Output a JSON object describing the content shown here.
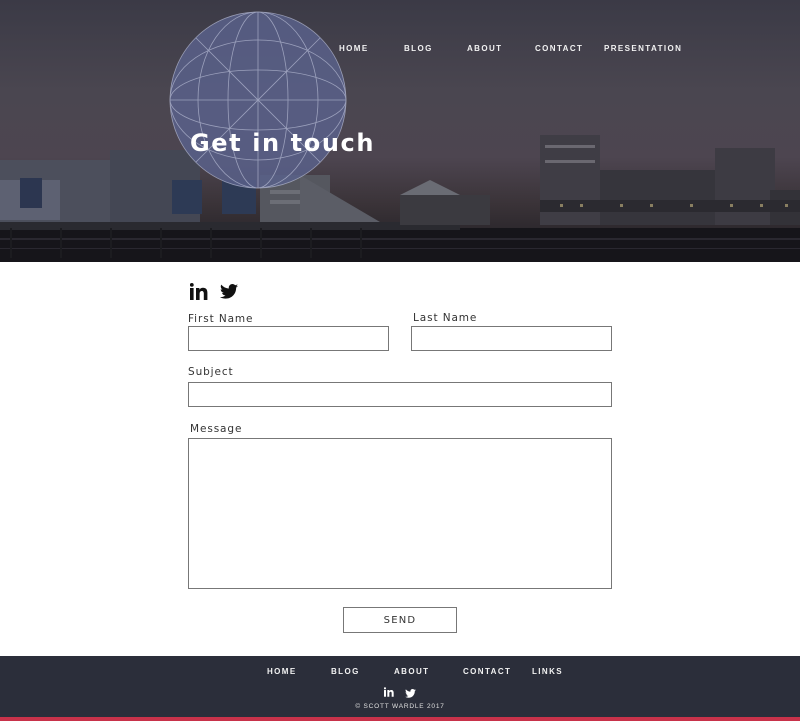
{
  "nav": {
    "items": [
      {
        "label": "HOME"
      },
      {
        "label": "BLOG"
      },
      {
        "label": "ABOUT"
      },
      {
        "label": "CONTACT"
      },
      {
        "label": "PRESENTATION"
      }
    ]
  },
  "hero": {
    "title": "Get in touch"
  },
  "social": {
    "icons": [
      "linkedin-icon",
      "twitter-icon"
    ]
  },
  "form": {
    "first_name_label": "First Name",
    "first_name_value": "",
    "last_name_label": "Last Name",
    "last_name_value": "",
    "subject_label": "Subject",
    "subject_value": "",
    "message_label": "Message",
    "message_value": "",
    "send_label": "SEND"
  },
  "footer": {
    "items": [
      {
        "label": "HOME"
      },
      {
        "label": "BLOG"
      },
      {
        "label": "ABOUT"
      },
      {
        "label": "CONTACT"
      },
      {
        "label": "LINKS"
      }
    ],
    "copyright": "© SCOTT WARDLE 2017"
  },
  "colors": {
    "footer_bg": "#2b2e3a",
    "accent": "#c8324a",
    "hero_overlay": "#3b3a46"
  }
}
